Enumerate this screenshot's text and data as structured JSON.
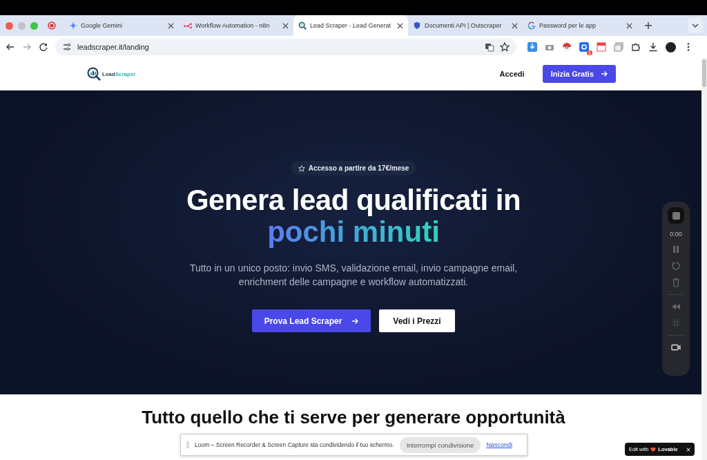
{
  "browser": {
    "tabs": [
      {
        "title": "Google Gemini",
        "kind": "sparkle",
        "selected": false
      },
      {
        "title": "Workflow Automation - n8n",
        "kind": "nodes",
        "selected": false
      },
      {
        "title": "Lead Scraper - Lead Generat",
        "kind": "magnifier",
        "selected": true
      },
      {
        "title": "Documenti API | Outscraper",
        "kind": "shield",
        "selected": false
      },
      {
        "title": "Password per le app",
        "kind": "google",
        "selected": false
      }
    ],
    "address": "leadscraper.it/landing",
    "extension_badge": "1"
  },
  "page": {
    "logo": {
      "part_1": "Lead",
      "part_2": "Scraper"
    },
    "nav": {
      "login": "Accedi",
      "cta": "Inizia Gratis"
    },
    "hero": {
      "badge": "Accesso a partire da 17€/mese",
      "title": "Genera lead qualificati in",
      "title_highlight": "pochi minuti",
      "subtitle": "Tutto in un unico posto: invio SMS, validazione email, invio campagne email, enrichment delle campagne e workflow automatizzati.",
      "primary_button": "Prova Lead Scraper",
      "secondary_button": "Vedi i Prezzi"
    },
    "section_heading": "Tutto quello che ti serve per generare opportunità"
  },
  "recorder": {
    "timer": "0:00"
  },
  "share_bar": {
    "message": "Loom – Screen Recorder & Screen Capture sta condividendo il tuo schermo.",
    "stop_button": "Interrompi condivisione",
    "hide_link": "Nascondi"
  },
  "lovable_badge": {
    "label": "Edit with",
    "brand": "Lovable"
  }
}
